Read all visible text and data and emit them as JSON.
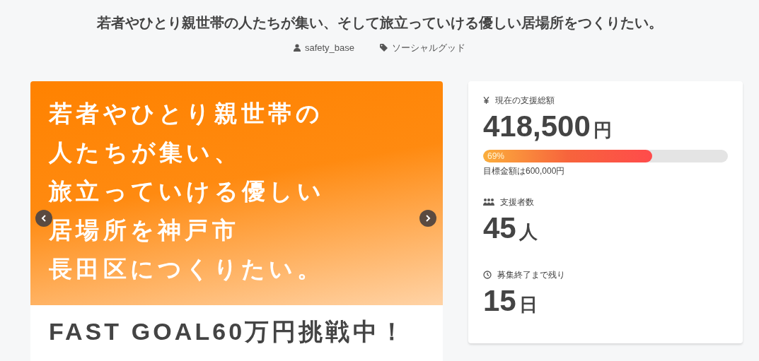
{
  "title": "若者やひとり親世帯の人たちが集い、そして旅立っていける優しい居場所をつくりたい。",
  "meta": {
    "author": "safety_base",
    "category": "ソーシャルグッド"
  },
  "slider": {
    "headline_lines": [
      "若者やひとり親世帯の",
      "人たちが集い、",
      "旅立っていける優しい",
      "居場所を神戸市",
      "長田区につくりたい。"
    ],
    "banner": "FAST GOAL60万円挑戦中！"
  },
  "stats": {
    "funding": {
      "label": "現在の支援総額",
      "amount": "418,500",
      "unit": "円",
      "progress": {
        "level": 0.69,
        "reading": "69%"
      },
      "goal": "目標金額は600,000円"
    },
    "supporters": {
      "label": "支援者数",
      "value": "45",
      "unit": "人"
    },
    "remaining": {
      "label": "募集終了まで残り",
      "value": "15",
      "unit": "日"
    }
  }
}
